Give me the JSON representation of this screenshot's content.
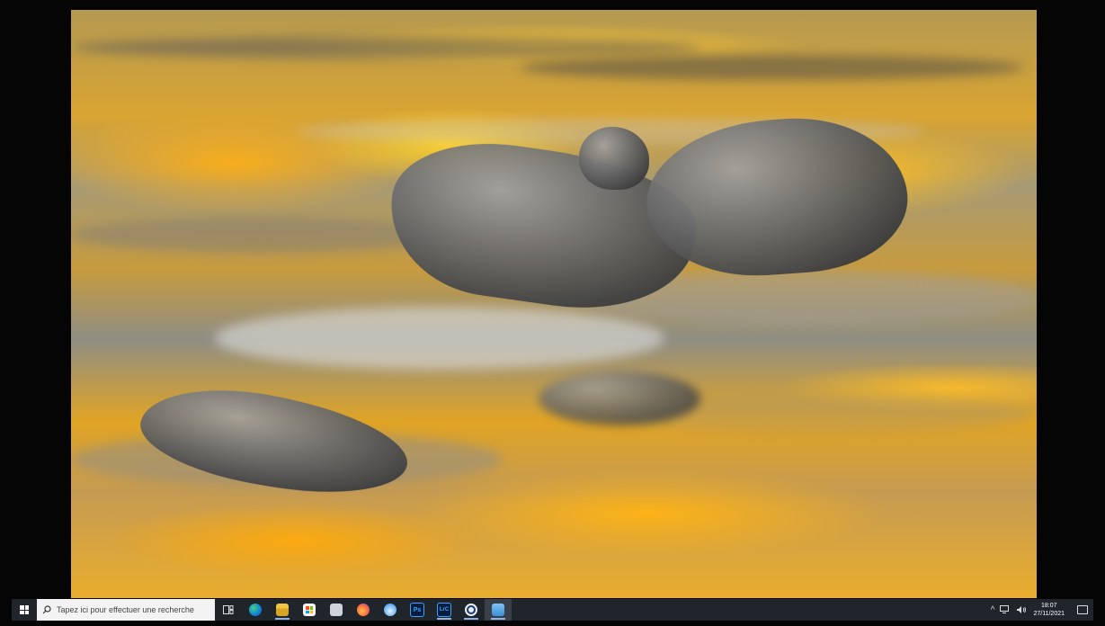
{
  "desktop": {
    "wallpaper_description": "",
    "colors": {
      "taskbar_bg": "#20242b",
      "accent": "#8ab4e6"
    }
  },
  "taskbar": {
    "search": {
      "placeholder": "Tapez ici pour effectuer une recherche",
      "icon": "search-icon"
    },
    "apps": [
      {
        "name": "task-view",
        "icon": "task-view-icon",
        "label": ""
      },
      {
        "name": "edge",
        "icon": "edge-icon",
        "label": ""
      },
      {
        "name": "file-explorer",
        "icon": "folder-icon",
        "label": ""
      },
      {
        "name": "store",
        "icon": "store-icon",
        "label": ""
      },
      {
        "name": "app-unknown",
        "icon": "app-icon",
        "label": ""
      },
      {
        "name": "firefox",
        "icon": "firefox-icon",
        "label": ""
      },
      {
        "name": "cloud-app",
        "icon": "cloud-icon",
        "label": ""
      },
      {
        "name": "photoshop",
        "icon": "photoshop-icon",
        "label": "Ps"
      },
      {
        "name": "lightroom-classic",
        "icon": "lightroom-icon",
        "label": "LrC"
      },
      {
        "name": "app-circle",
        "icon": "app-circle-icon",
        "label": ""
      },
      {
        "name": "photo-viewer",
        "icon": "image-icon",
        "label": ""
      }
    ],
    "tray": {
      "chevron": "^",
      "network_icon": "network-icon",
      "volume_icon": "volume-icon",
      "time": "18:07",
      "date": "27/11/2021"
    }
  }
}
